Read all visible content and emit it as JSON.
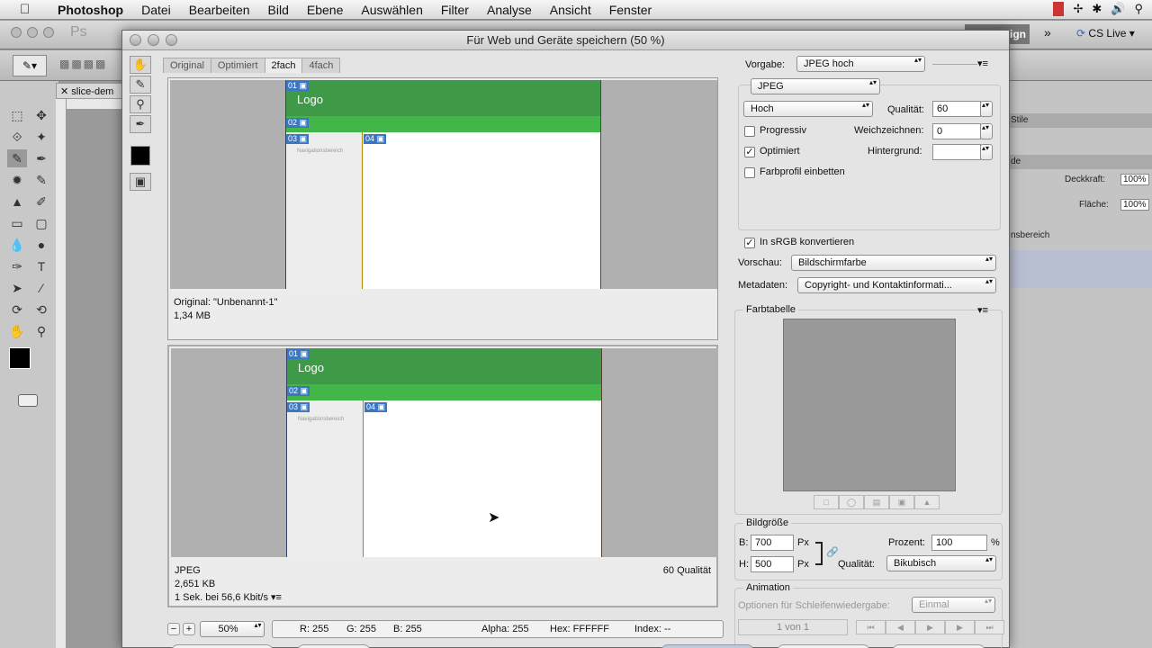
{
  "menubar": {
    "app": "Photoshop",
    "items": [
      "Datei",
      "Bearbeiten",
      "Bild",
      "Ebene",
      "Auswählen",
      "Filter",
      "Analyse",
      "Ansicht",
      "Fenster"
    ]
  },
  "appbar": {
    "cs_live": "CS Live",
    "design_label": "ign"
  },
  "doc_tab": "slice-dem",
  "dialog": {
    "title": "Für Web und Geräte speichern (50 %)",
    "view_tabs": [
      "Original",
      "Optimiert",
      "2fach",
      "4fach"
    ],
    "active_tab": "2fach",
    "preview_top": {
      "slices": [
        "01",
        "02",
        "03",
        "04"
      ],
      "logo": "Logo",
      "nav_text": "Navigationsbereich",
      "info_line1": "Original: \"Unbenannt-1\"",
      "info_line2": "1,34 MB"
    },
    "preview_bottom": {
      "slices": [
        "01",
        "02",
        "03",
        "04"
      ],
      "logo": "Logo",
      "nav_text": "Navigationsbereich",
      "format": "JPEG",
      "size": "2,651 KB",
      "speed": "1 Sek. bei 56,6 Kbit/s",
      "quality": "60 Qualität"
    },
    "status": {
      "zoom": "50%",
      "r": "R: 255",
      "g": "G: 255",
      "b": "B: 255",
      "alpha": "Alpha: 255",
      "hex": "Hex: FFFFFF",
      "index": "Index: --"
    },
    "settings": {
      "vorgabe_label": "Vorgabe:",
      "vorgabe_value": "JPEG hoch",
      "format_value": "JPEG",
      "compression_value": "Hoch",
      "qualitaet_label": "Qualität:",
      "qualitaet_value": "60",
      "progressiv_label": "Progressiv",
      "progressiv_checked": false,
      "weichzeichnen_label": "Weichzeichnen:",
      "weichzeichnen_value": "0",
      "optimiert_label": "Optimiert",
      "optimiert_checked": true,
      "hintergrund_label": "Hintergrund:",
      "farbprofil_label": "Farbprofil einbetten",
      "farbprofil_checked": false,
      "srgb_label": "In sRGB konvertieren",
      "srgb_checked": true,
      "vorschau_label": "Vorschau:",
      "vorschau_value": "Bildschirmfarbe",
      "metadaten_label": "Metadaten:",
      "metadaten_value": "Copyright- und Kontaktinformati..."
    },
    "farbtabelle": {
      "title": "Farbtabelle"
    },
    "bildgroesse": {
      "title": "Bildgröße",
      "b_label": "B:",
      "b_value": "700",
      "h_label": "H:",
      "h_value": "500",
      "unit": "Px",
      "prozent_label": "Prozent:",
      "prozent_value": "100",
      "percent_sign": "%",
      "qualitaet_label": "Qualität:",
      "qualitaet_value": "Bikubisch"
    },
    "animation": {
      "title": "Animation",
      "loop_label": "Optionen für Schleifenwiedergabe:",
      "loop_value": "Einmal",
      "frame": "1 von 1"
    }
  },
  "right_panel": {
    "stile": "Stile",
    "de": "de",
    "deckkraft_label": "Deckkraft:",
    "deckkraft_value": "100%",
    "flaeche_label": "Fläche:",
    "flaeche_value": "100%",
    "layer": "nsbereich"
  }
}
